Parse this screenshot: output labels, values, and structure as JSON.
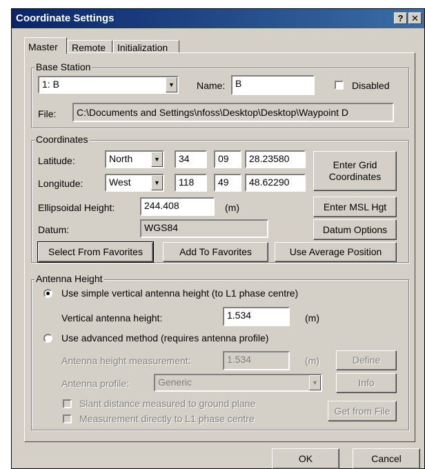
{
  "window": {
    "title": "Coordinate Settings",
    "help_label": "?",
    "close_label": "✕"
  },
  "tabs": [
    "Master",
    "Remote",
    "Initialization"
  ],
  "base_station": {
    "group_label": "Base Station",
    "station_value": "1: B",
    "name_label": "Name:",
    "name_value": "B",
    "disabled_label": "Disabled",
    "file_label": "File:",
    "file_value": "C:\\Documents and Settings\\nfoss\\Desktop\\Desktop\\Waypoint D"
  },
  "coordinates": {
    "group_label": "Coordinates",
    "latitude_label": "Latitude:",
    "lat_hemisphere": "North",
    "lat_deg": "34",
    "lat_min": "09",
    "lat_sec": "28.23580",
    "longitude_label": "Longitude:",
    "lon_hemisphere": "West",
    "lon_deg": "118",
    "lon_min": "49",
    "lon_sec": "48.62290",
    "ellipsoidal_label": "Ellipsoidal Height:",
    "ellipsoidal_value": "244.408",
    "ellipsoidal_unit": "(m)",
    "datum_label": "Datum:",
    "datum_value": "WGS84",
    "enter_grid_line1": "Enter Grid",
    "enter_grid_line2": "Coordinates",
    "enter_msl": "Enter MSL Hgt",
    "datum_options": "Datum Options",
    "select_favorites": "Select From Favorites",
    "add_favorites": "Add To Favorites",
    "use_average": "Use Average Position"
  },
  "antenna": {
    "group_label": "Antenna Height",
    "simple_label": "Use simple vertical antenna height (to L1 phase centre)",
    "vertical_label": "Vertical antenna height:",
    "vertical_value": "1.534",
    "vertical_unit": "(m)",
    "advanced_label": "Use advanced method (requires antenna profile)",
    "measurement_label": "Antenna height measurement:",
    "measurement_value": "1.534",
    "measurement_unit": "(m)",
    "define_label": "Define",
    "profile_label": "Antenna profile:",
    "profile_value": "Generic",
    "info_label": "Info",
    "slant_label": "Slant distance measured to ground plane",
    "direct_label": "Measurement directly to L1 phase centre",
    "get_file_label": "Get from File"
  },
  "footer": {
    "ok_label": "OK",
    "cancel_label": "Cancel"
  }
}
